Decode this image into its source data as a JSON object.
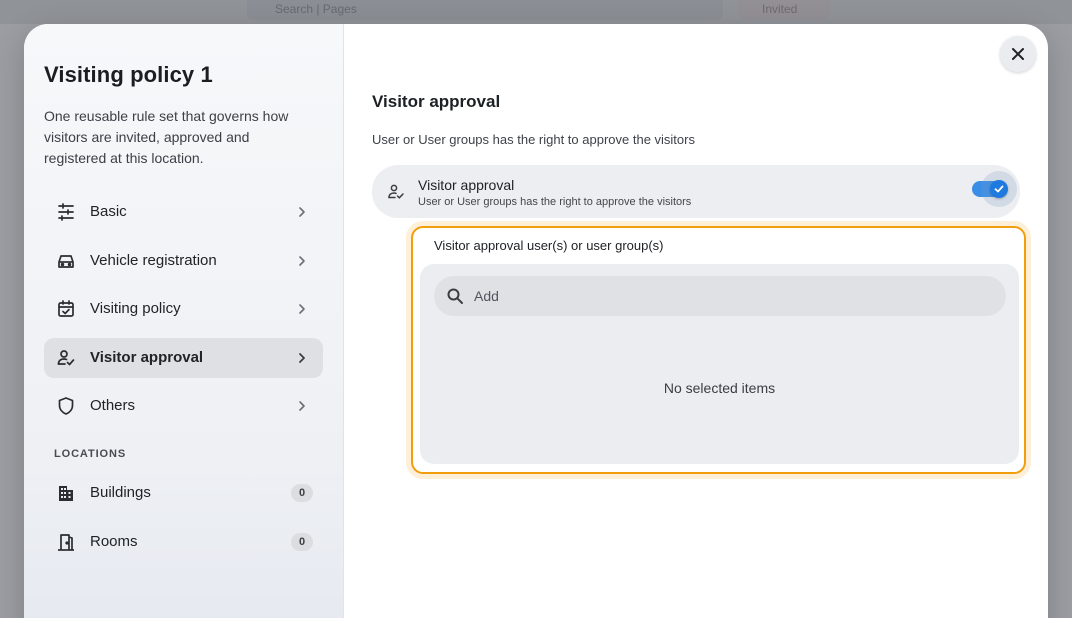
{
  "background": {
    "search_text": "Search | Pages",
    "pill_text": "Invited"
  },
  "colors": {
    "accent": "#1f7ae0",
    "highlight": "#f29d0c",
    "sidebar_bg": "#eef0f4"
  },
  "sidebar": {
    "title": "Visiting policy 1",
    "description": "One reusable rule set that governs how visitors are invited, approved and registered at this location.",
    "items": [
      {
        "label": "Basic",
        "icon": "sliders-icon",
        "active": false
      },
      {
        "label": "Vehicle registration",
        "icon": "car-icon",
        "active": false
      },
      {
        "label": "Visiting policy",
        "icon": "calendar-check-icon",
        "active": false
      },
      {
        "label": "Visitor approval",
        "icon": "person-check-icon",
        "active": true
      },
      {
        "label": "Others",
        "icon": "shield-icon",
        "active": false
      }
    ],
    "locations_heading": "LOCATIONS",
    "locations": [
      {
        "label": "Buildings",
        "icon": "building-icon",
        "count": "0"
      },
      {
        "label": "Rooms",
        "icon": "door-icon",
        "count": "0"
      }
    ]
  },
  "main": {
    "section_title": "Visitor approval",
    "section_description": "User or User groups has the right to approve the visitors",
    "toggle": {
      "label": "Visitor approval",
      "sublabel": "User or User groups has the right to approve the visitors",
      "enabled": true
    },
    "picker": {
      "label": "Visitor approval user(s) or user group(s)",
      "search_placeholder": "Add",
      "empty_text": "No selected items"
    }
  }
}
